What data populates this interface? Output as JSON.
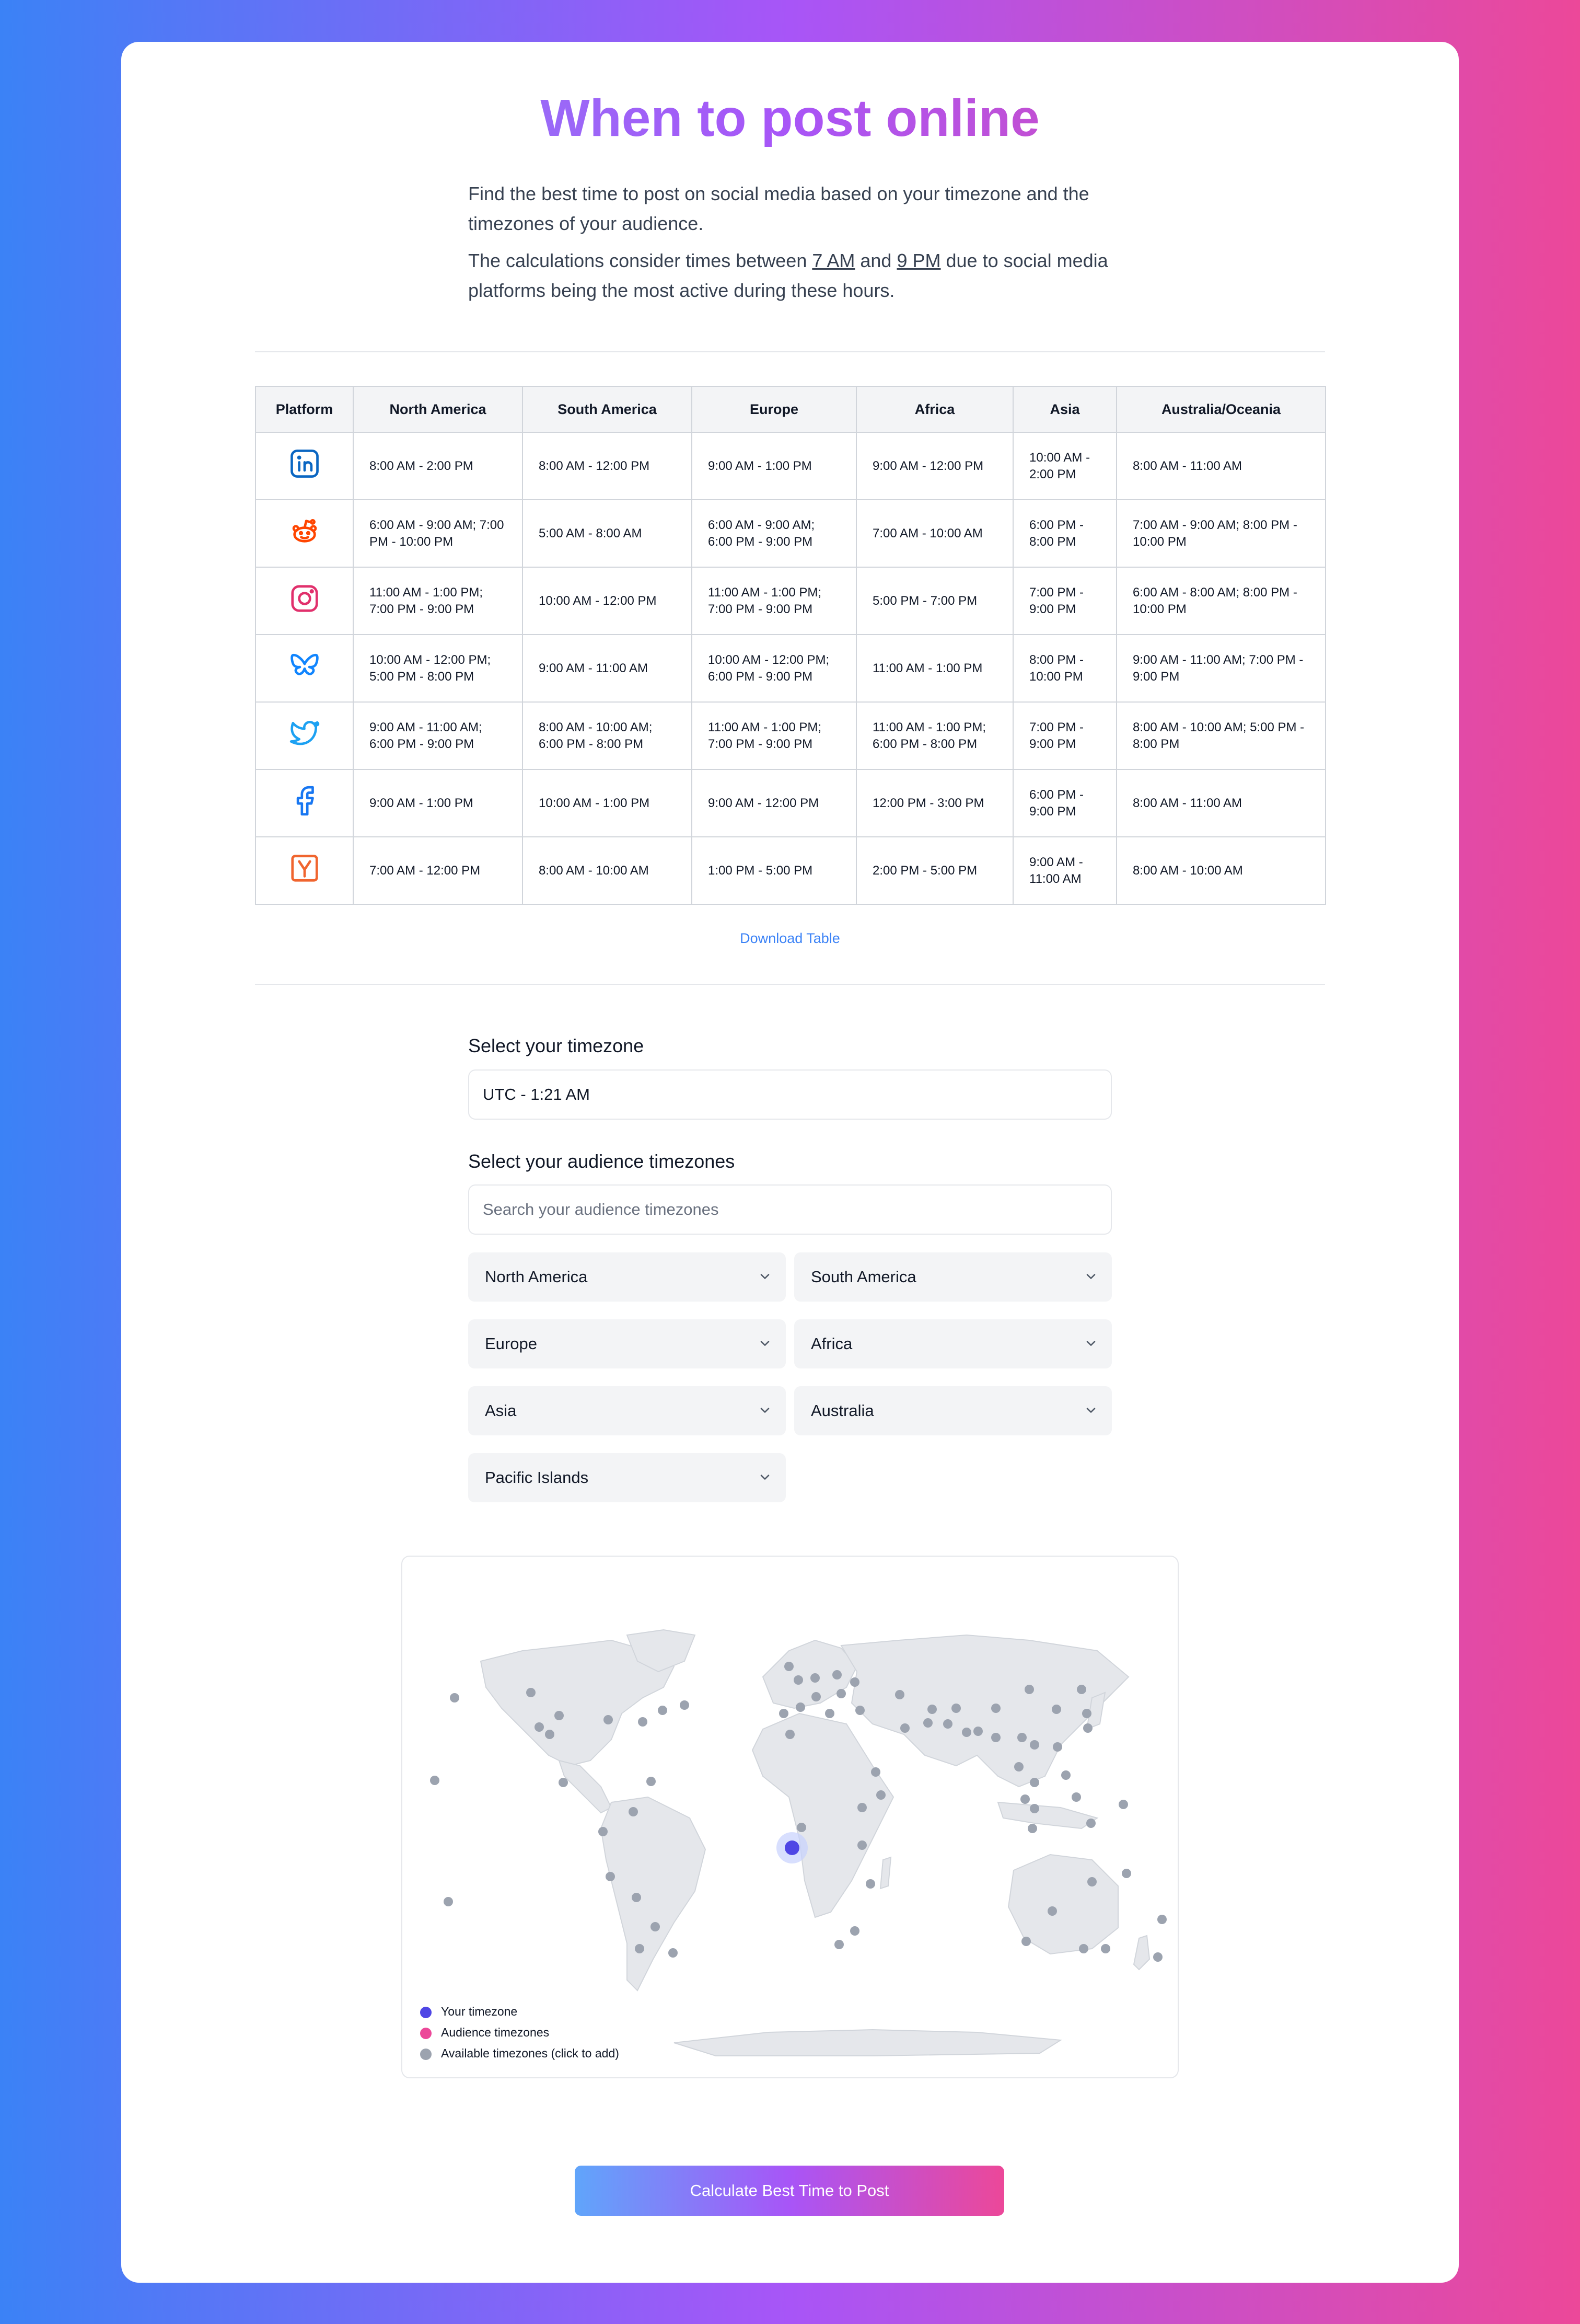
{
  "title": "When to post online",
  "intro": {
    "p1": "Find the best time to post on social media based on your timezone and the timezones of your audience.",
    "p2_before": "The calculations consider times between ",
    "start_time": "7 AM",
    "p2_and": " and ",
    "end_time": "9 PM",
    "p2_after": " due to social media platforms being the most active during these hours."
  },
  "table": {
    "headers": [
      "Platform",
      "North America",
      "South America",
      "Europe",
      "Africa",
      "Asia",
      "Australia/Oceania"
    ],
    "rows": [
      {
        "platform_icon": "linkedin-icon",
        "color": "#0a66c2",
        "cells": [
          "8:00 AM - 2:00 PM",
          "8:00 AM - 12:00 PM",
          "9:00 AM - 1:00 PM",
          "9:00 AM - 12:00 PM",
          "10:00 AM - 2:00 PM",
          "8:00 AM - 11:00 AM"
        ]
      },
      {
        "platform_icon": "reddit-icon",
        "color": "#ff4500",
        "cells": [
          "6:00 AM - 9:00 AM; 7:00 PM - 10:00 PM",
          "5:00 AM - 8:00 AM",
          "6:00 AM - 9:00 AM; 6:00 PM - 9:00 PM",
          "7:00 AM - 10:00 AM",
          "6:00 PM - 8:00 PM",
          "7:00 AM - 9:00 AM; 8:00 PM - 10:00 PM"
        ]
      },
      {
        "platform_icon": "instagram-icon",
        "color": "#e1306c",
        "cells": [
          "11:00 AM - 1:00 PM; 7:00 PM - 9:00 PM",
          "10:00 AM - 12:00 PM",
          "11:00 AM - 1:00 PM; 7:00 PM - 9:00 PM",
          "5:00 PM - 7:00 PM",
          "7:00 PM - 9:00 PM",
          "6:00 AM - 8:00 AM; 8:00 PM - 10:00 PM"
        ]
      },
      {
        "platform_icon": "bluesky-icon",
        "color": "#1185fe",
        "cells": [
          "10:00 AM - 12:00 PM; 5:00 PM - 8:00 PM",
          "9:00 AM - 11:00 AM",
          "10:00 AM - 12:00 PM; 6:00 PM - 9:00 PM",
          "11:00 AM - 1:00 PM",
          "8:00 PM - 10:00 PM",
          "9:00 AM - 11:00 AM; 7:00 PM - 9:00 PM"
        ]
      },
      {
        "platform_icon": "twitter-icon",
        "color": "#1da1f2",
        "cells": [
          "9:00 AM - 11:00 AM; 6:00 PM - 9:00 PM",
          "8:00 AM - 10:00 AM; 6:00 PM - 8:00 PM",
          "11:00 AM - 1:00 PM; 7:00 PM - 9:00 PM",
          "11:00 AM - 1:00 PM; 6:00 PM - 8:00 PM",
          "7:00 PM - 9:00 PM",
          "8:00 AM - 10:00 AM; 5:00 PM - 8:00 PM"
        ]
      },
      {
        "platform_icon": "facebook-icon",
        "color": "#1877f2",
        "cells": [
          "9:00 AM - 1:00 PM",
          "10:00 AM - 1:00 PM",
          "9:00 AM - 12:00 PM",
          "12:00 PM - 3:00 PM",
          "6:00 PM - 9:00 PM",
          "8:00 AM - 11:00 AM"
        ]
      },
      {
        "platform_icon": "hackernews-icon",
        "color": "#f0652f",
        "cells": [
          "7:00 AM - 12:00 PM",
          "8:00 AM - 10:00 AM",
          "1:00 PM - 5:00 PM",
          "2:00 PM - 5:00 PM",
          "9:00 AM - 11:00 AM",
          "8:00 AM - 10:00 AM"
        ]
      }
    ]
  },
  "download_label": "Download Table",
  "timezone": {
    "label": "Select your timezone",
    "value": "UTC - 1:21 AM"
  },
  "audience": {
    "label": "Select your audience timezones",
    "search_placeholder": "Search your audience timezones",
    "regions": [
      "North America",
      "South America",
      "Europe",
      "Africa",
      "Asia",
      "Australia",
      "Pacific Islands"
    ]
  },
  "map": {
    "legend": [
      {
        "label": "Your timezone",
        "color": "#4f46e5"
      },
      {
        "label": "Audience timezones",
        "color": "#ec4899"
      },
      {
        "label": "Available timezones (click to add)",
        "color": "#9ca3af"
      }
    ]
  },
  "calculate_label": "Calculate Best Time to Post"
}
